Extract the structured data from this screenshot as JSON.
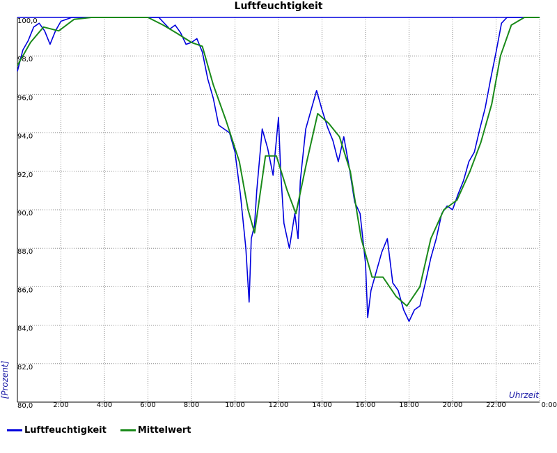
{
  "chart_data": {
    "type": "line",
    "title": "Luftfeuchtigkeit",
    "ylabel": "[Prozent]",
    "xlabel": "Uhrzeit",
    "ylim": [
      80,
      100
    ],
    "xlim": [
      0,
      24
    ],
    "grid": true,
    "legend_position": "bottom-left",
    "y_ticks": [
      "80,0",
      "82,0",
      "84,0",
      "86,0",
      "88,0",
      "90,0",
      "92,0",
      "94,0",
      "96,0",
      "98,0",
      "100,0"
    ],
    "x_ticks": [
      "2:00",
      "4:00",
      "6:00",
      "8:00",
      "10:00",
      "12:00",
      "14:00",
      "16:00",
      "18:00",
      "20:00",
      "22:00",
      "0:00"
    ],
    "series": [
      {
        "name": "Luftfeuchtigkeit",
        "color": "#0000dd",
        "x": [
          0,
          0.25,
          0.5,
          0.75,
          1.0,
          1.25,
          1.5,
          1.75,
          2.0,
          2.25,
          2.5,
          3.0,
          3.5,
          4.0,
          5.0,
          6.0,
          6.5,
          7.0,
          7.25,
          7.5,
          7.75,
          8.0,
          8.25,
          8.5,
          8.75,
          9.0,
          9.25,
          9.5,
          9.75,
          10.0,
          10.25,
          10.5,
          10.65,
          10.75,
          10.9,
          11.0,
          11.25,
          11.5,
          11.75,
          12.0,
          12.1,
          12.25,
          12.5,
          12.75,
          12.9,
          13.0,
          13.25,
          13.5,
          13.75,
          14.0,
          14.25,
          14.5,
          14.75,
          15.0,
          15.25,
          15.5,
          15.75,
          16.0,
          16.1,
          16.25,
          16.5,
          16.75,
          17.0,
          17.25,
          17.5,
          17.75,
          18.0,
          18.25,
          18.5,
          18.75,
          19.0,
          19.25,
          19.5,
          19.75,
          20.0,
          20.25,
          20.5,
          20.75,
          21.0,
          21.25,
          21.5,
          21.75,
          22.0,
          22.25,
          22.5,
          23.0,
          24.0
        ],
        "values": [
          97.2,
          98.3,
          98.8,
          99.5,
          99.7,
          99.3,
          98.6,
          99.3,
          99.8,
          99.9,
          100.0,
          100.0,
          100.0,
          100.0,
          100.0,
          100.0,
          100.0,
          99.4,
          99.6,
          99.2,
          98.6,
          98.7,
          98.9,
          98.2,
          96.8,
          95.8,
          94.4,
          94.2,
          94.0,
          93.0,
          90.8,
          88.0,
          85.2,
          88.5,
          89.2,
          91.0,
          94.2,
          93.2,
          91.8,
          94.8,
          92.0,
          89.3,
          88.0,
          89.8,
          88.5,
          91.5,
          94.2,
          95.2,
          96.2,
          95.2,
          94.3,
          93.6,
          92.5,
          93.8,
          92.2,
          90.4,
          89.8,
          87.2,
          84.4,
          85.8,
          86.8,
          87.8,
          88.5,
          86.2,
          85.8,
          84.8,
          84.2,
          84.8,
          85.0,
          86.2,
          87.5,
          88.5,
          89.8,
          90.2,
          90.0,
          90.8,
          91.5,
          92.5,
          93.0,
          94.2,
          95.3,
          96.8,
          98.2,
          99.7,
          100.0,
          100.0,
          100.0
        ]
      },
      {
        "name": "Mittelwert",
        "color": "#1a8a1a",
        "x": [
          0,
          0.6,
          1.2,
          1.9,
          2.6,
          3.4,
          4.2,
          5.0,
          6.0,
          6.7,
          7.3,
          8.0,
          8.5,
          9.0,
          9.6,
          10.2,
          10.6,
          10.9,
          11.4,
          11.9,
          12.4,
          12.8,
          13.3,
          13.8,
          14.3,
          14.8,
          15.3,
          15.8,
          16.3,
          16.8,
          17.4,
          17.9,
          18.5,
          19.0,
          19.6,
          20.2,
          20.8,
          21.3,
          21.8,
          22.2,
          22.7,
          23.3,
          24.0
        ],
        "values": [
          97.5,
          98.7,
          99.5,
          99.3,
          99.9,
          100.0,
          100.0,
          100.0,
          100.0,
          99.6,
          99.2,
          98.7,
          98.5,
          96.5,
          94.6,
          92.5,
          90.0,
          88.8,
          92.8,
          92.8,
          91.0,
          89.8,
          92.5,
          95.0,
          94.5,
          93.8,
          92.0,
          88.5,
          86.5,
          86.5,
          85.5,
          85.0,
          86.0,
          88.5,
          90.0,
          90.5,
          92.0,
          93.5,
          95.5,
          98.0,
          99.6,
          100.0,
          100.0
        ]
      }
    ]
  }
}
